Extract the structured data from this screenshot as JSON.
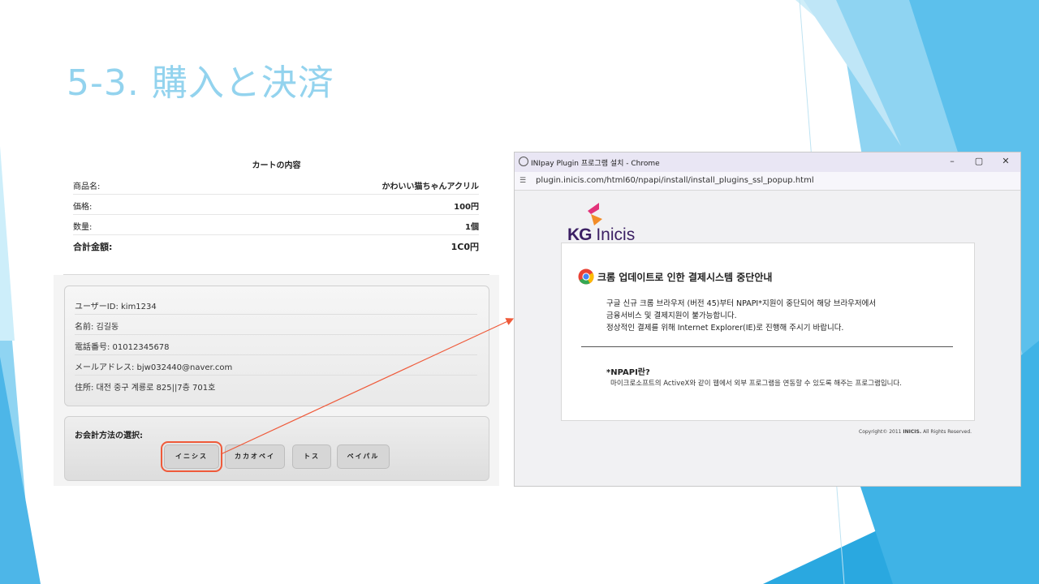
{
  "slide": {
    "title": "5-3. 購入と決済"
  },
  "cart": {
    "heading": "カートの内容",
    "rows": [
      {
        "label": "商品名:",
        "value": "かわいい猫ちゃんアクリル"
      },
      {
        "label": "価格:",
        "value": "100円"
      },
      {
        "label": "数量:",
        "value": "1個"
      }
    ],
    "total": {
      "label": "合計金額:",
      "value": "1C0円"
    },
    "user": {
      "id": "ユーザーID: kim1234",
      "name": "名前: 김길동",
      "phone": "電話番号: 01012345678",
      "email": "メールアドレス: bjw032440@naver.com",
      "address": "住所: 대전 중구 계룡로 825||7층 701호"
    },
    "payment": {
      "title": "お会計方法の選択:",
      "options": [
        "イニシス",
        "カカオペイ",
        "トス",
        "ペイパル"
      ],
      "highlighted_option": "イニシス"
    }
  },
  "popup": {
    "window_title": "INIpay Plugin 프로그램 설치 - Chrome",
    "url": "plugin.inicis.com/html60/npapi/install/install_plugins_ssl_popup.html",
    "logo": {
      "kg": "KG",
      "brand": "Inicis"
    },
    "notice_heading": "크롬 업데이트로 인한 결제시스템 중단안내",
    "notice_lines": [
      "구글 신규 크롬 브라우저 (버전 45)부터 NPAPI*지원이 중단되어 해당 브라우저에서",
      "금융서비스 및 결제지원이 불가능합니다.",
      "정상적인 결제를 위해 Internet Explorer(IE)로 진행해 주시기 바랍니다."
    ],
    "npapi_heading": "*NPAPI란?",
    "npapi_desc": "마이크로소프트의 ActiveX와 같이 웹에서 외부 프로그램을 연동할 수 있도록 해주는 프로그램입니다.",
    "copyright_prefix": "Copyright© 2011",
    "copyright_brand": "INICIS.",
    "copyright_suffix": "All Rights Reserved."
  },
  "colors": {
    "accent_title": "#93d3ee",
    "highlight_red": "#ef5a3a",
    "inicis_purple": "#3b1f63",
    "deco_blue": "#4db6e8"
  }
}
